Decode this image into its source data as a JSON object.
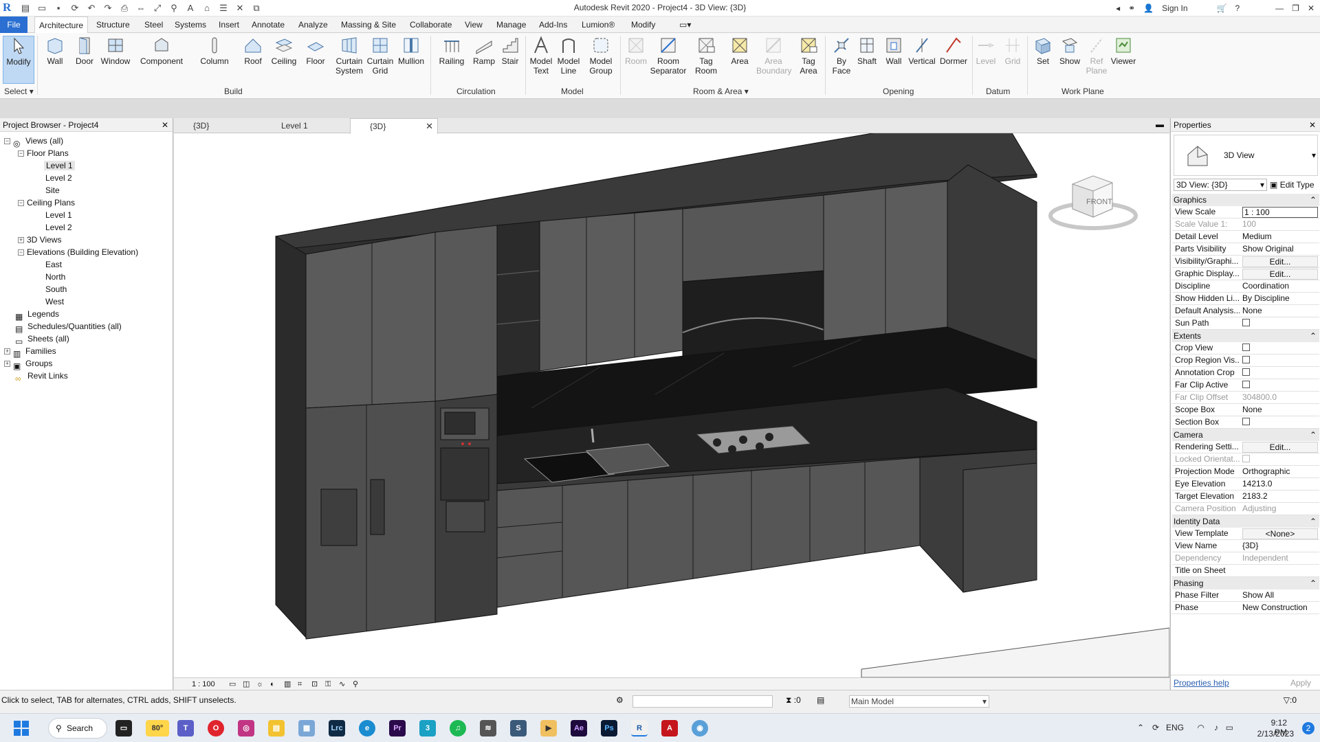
{
  "titlebar": {
    "title": "Autodesk Revit 2020 - Project4 - 3D View: {3D}",
    "sign_in": "Sign In"
  },
  "tabs": [
    "File",
    "Architecture",
    "Structure",
    "Steel",
    "Systems",
    "Insert",
    "Annotate",
    "Analyze",
    "Massing & Site",
    "Collaborate",
    "View",
    "Manage",
    "Add-Ins",
    "Lumion®",
    "Modify"
  ],
  "ribbon": {
    "select_label": "Select",
    "buttons": [
      {
        "label": "Modify",
        "icon": "pointer-icon"
      },
      {
        "label": "Wall",
        "icon": "wall-icon"
      },
      {
        "label": "Door",
        "icon": "door-icon"
      },
      {
        "label": "Window",
        "icon": "window-icon"
      },
      {
        "label": "Component",
        "icon": "component-icon"
      },
      {
        "label": "Column",
        "icon": "column-icon"
      },
      {
        "label": "Roof",
        "icon": "roof-icon"
      },
      {
        "label": "Ceiling",
        "icon": "ceiling-icon"
      },
      {
        "label": "Floor",
        "icon": "floor-icon"
      },
      {
        "label": "Curtain System",
        "icon": "curtain-system-icon"
      },
      {
        "label": "Curtain Grid",
        "icon": "curtain-grid-icon"
      },
      {
        "label": "Mullion",
        "icon": "mullion-icon"
      },
      {
        "label": "Railing",
        "icon": "railing-icon"
      },
      {
        "label": "Ramp",
        "icon": "ramp-icon"
      },
      {
        "label": "Stair",
        "icon": "stair-icon"
      },
      {
        "label": "Model Text",
        "icon": "model-text-icon"
      },
      {
        "label": "Model Line",
        "icon": "model-line-icon"
      },
      {
        "label": "Model Group",
        "icon": "model-group-icon"
      },
      {
        "label": "Room",
        "icon": "room-icon"
      },
      {
        "label": "Room Separator",
        "icon": "room-separator-icon"
      },
      {
        "label": "Tag Room",
        "icon": "tag-room-icon"
      },
      {
        "label": "Area",
        "icon": "area-icon"
      },
      {
        "label": "Area Boundary",
        "icon": "area-boundary-icon"
      },
      {
        "label": "Tag Area",
        "icon": "tag-area-icon"
      },
      {
        "label": "By Face",
        "icon": "by-face-icon"
      },
      {
        "label": "Shaft",
        "icon": "shaft-icon"
      },
      {
        "label": "Wall",
        "icon": "wall-opening-icon"
      },
      {
        "label": "Vertical",
        "icon": "vertical-icon"
      },
      {
        "label": "Dormer",
        "icon": "dormer-icon"
      },
      {
        "label": "Level",
        "icon": "level-icon"
      },
      {
        "label": "Grid",
        "icon": "grid-icon"
      },
      {
        "label": "Set",
        "icon": "set-icon"
      },
      {
        "label": "Show",
        "icon": "show-icon"
      },
      {
        "label": "Ref Plane",
        "icon": "ref-plane-icon"
      },
      {
        "label": "Viewer",
        "icon": "viewer-icon"
      }
    ],
    "panels": [
      "Build",
      "Circulation",
      "Model",
      "Room & Area",
      "Opening",
      "Datum",
      "Work Plane"
    ]
  },
  "project_browser": {
    "title": "Project Browser - Project4",
    "items": [
      "Views (all)",
      "Floor Plans",
      "Level 1",
      "Level 2",
      "Site",
      "Ceiling Plans",
      "Level 1",
      "Level 2",
      "3D Views",
      "Elevations (Building Elevation)",
      "East",
      "North",
      "South",
      "West",
      "Legends",
      "Schedules/Quantities (all)",
      "Sheets (all)",
      "Families",
      "Groups",
      "Revit Links"
    ]
  },
  "view_tabs": [
    "{3D}",
    "Level 1",
    "{3D}"
  ],
  "view_control": {
    "scale": "1 : 100"
  },
  "viewcube_label": "FRONT",
  "properties": {
    "title": "Properties",
    "type_name": "3D View",
    "type_select": "3D View: {3D}",
    "edit_type": "Edit Type",
    "sections": {
      "graphics": "Graphics",
      "extents": "Extents",
      "camera": "Camera",
      "identity": "Identity Data",
      "phasing": "Phasing"
    },
    "rows": {
      "view_scale": [
        "View Scale",
        "1 : 100"
      ],
      "scale_value": [
        "Scale Value    1:",
        "100"
      ],
      "detail_level": [
        "Detail Level",
        "Medium"
      ],
      "parts_visibility": [
        "Parts Visibility",
        "Show Original"
      ],
      "vis_graphics": [
        "Visibility/Graphi...",
        "Edit..."
      ],
      "graphic_display": [
        "Graphic Display...",
        "Edit..."
      ],
      "discipline": [
        "Discipline",
        "Coordination"
      ],
      "show_hidden": [
        "Show Hidden Li...",
        "By Discipline"
      ],
      "default_analysis": [
        "Default Analysis...",
        "None"
      ],
      "sun_path": [
        "Sun Path",
        ""
      ],
      "crop_view": [
        "Crop View",
        ""
      ],
      "crop_region": [
        "Crop Region Vis...",
        ""
      ],
      "annotation_crop": [
        "Annotation Crop",
        ""
      ],
      "far_clip_active": [
        "Far Clip Active",
        ""
      ],
      "far_clip_offset": [
        "Far Clip Offset",
        "304800.0"
      ],
      "scope_box": [
        "Scope Box",
        "None"
      ],
      "section_box": [
        "Section Box",
        ""
      ],
      "rendering": [
        "Rendering Setti...",
        "Edit..."
      ],
      "locked_orient": [
        "Locked Orientat...",
        ""
      ],
      "projection": [
        "Projection Mode",
        "Orthographic"
      ],
      "eye_elev": [
        "Eye Elevation",
        "14213.0"
      ],
      "target_elev": [
        "Target Elevation",
        "2183.2"
      ],
      "camera_pos": [
        "Camera Position",
        "Adjusting"
      ],
      "view_template": [
        "View Template",
        "<None>"
      ],
      "view_name": [
        "View Name",
        "{3D}"
      ],
      "dependency": [
        "Dependency",
        "Independent"
      ],
      "title_on_sheet": [
        "Title on Sheet",
        ""
      ],
      "phase_filter": [
        "Phase Filter",
        "Show All"
      ],
      "phase": [
        "Phase",
        "New Construction"
      ]
    },
    "help_link": "Properties help",
    "apply": "Apply"
  },
  "status": {
    "message": "Click to select, TAB for alternates, CTRL adds, SHIFT unselects.",
    "zero": ":0",
    "model": "Main Model",
    "filter": ":0"
  },
  "taskbar": {
    "search": "Search",
    "weather": "80°",
    "lang": "ENG",
    "time": "9:12 PM",
    "date": "2/13/2023",
    "notif": "2"
  },
  "colors": {
    "accent": "#2a6fd1",
    "ribbon_bg": "#f9f9f9",
    "model_dark": "#3b3b3b"
  }
}
